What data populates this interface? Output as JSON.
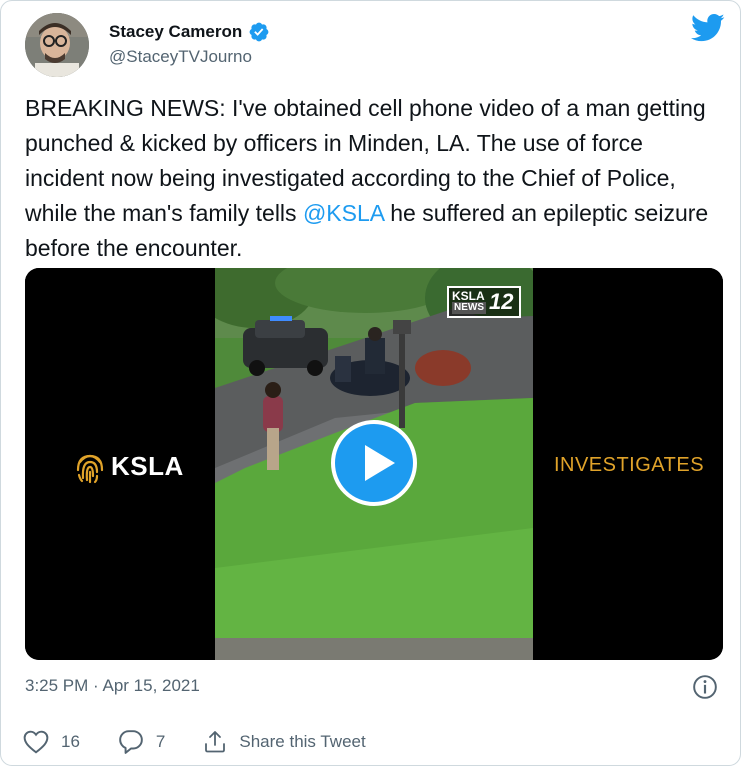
{
  "author": {
    "name": "Stacey Cameron",
    "handle": "@StaceyTVJourno",
    "verified": true
  },
  "tweet": {
    "text_before_mention": "BREAKING NEWS: I've obtained cell phone video of a man getting punched & kicked by officers in Minden, LA. The use of force incident now being investigated according to the Chief of Police, while the man's family tells ",
    "mention": "@KSLA",
    "text_after_mention": " he suffered an epileptic seizure before the encounter."
  },
  "media": {
    "left_logo": "KSLA",
    "right_label": "INVESTIGATES",
    "watermark_top": "KSLA",
    "watermark_bottom": "NEWS",
    "watermark_num": "12"
  },
  "meta": {
    "timestamp": "3:25 PM · Apr 15, 2021"
  },
  "actions": {
    "like_count": "16",
    "reply_count": "7",
    "share_label": "Share this Tweet"
  },
  "colors": {
    "twitter_blue": "#1d9bf0",
    "text_primary": "#0f1419",
    "text_secondary": "#536471",
    "investigates_gold": "#e0a32a"
  },
  "icons": [
    "verified-badge-icon",
    "twitter-bird-icon",
    "info-icon",
    "heart-icon",
    "reply-icon",
    "share-icon",
    "play-icon",
    "fingerprint-icon"
  ]
}
